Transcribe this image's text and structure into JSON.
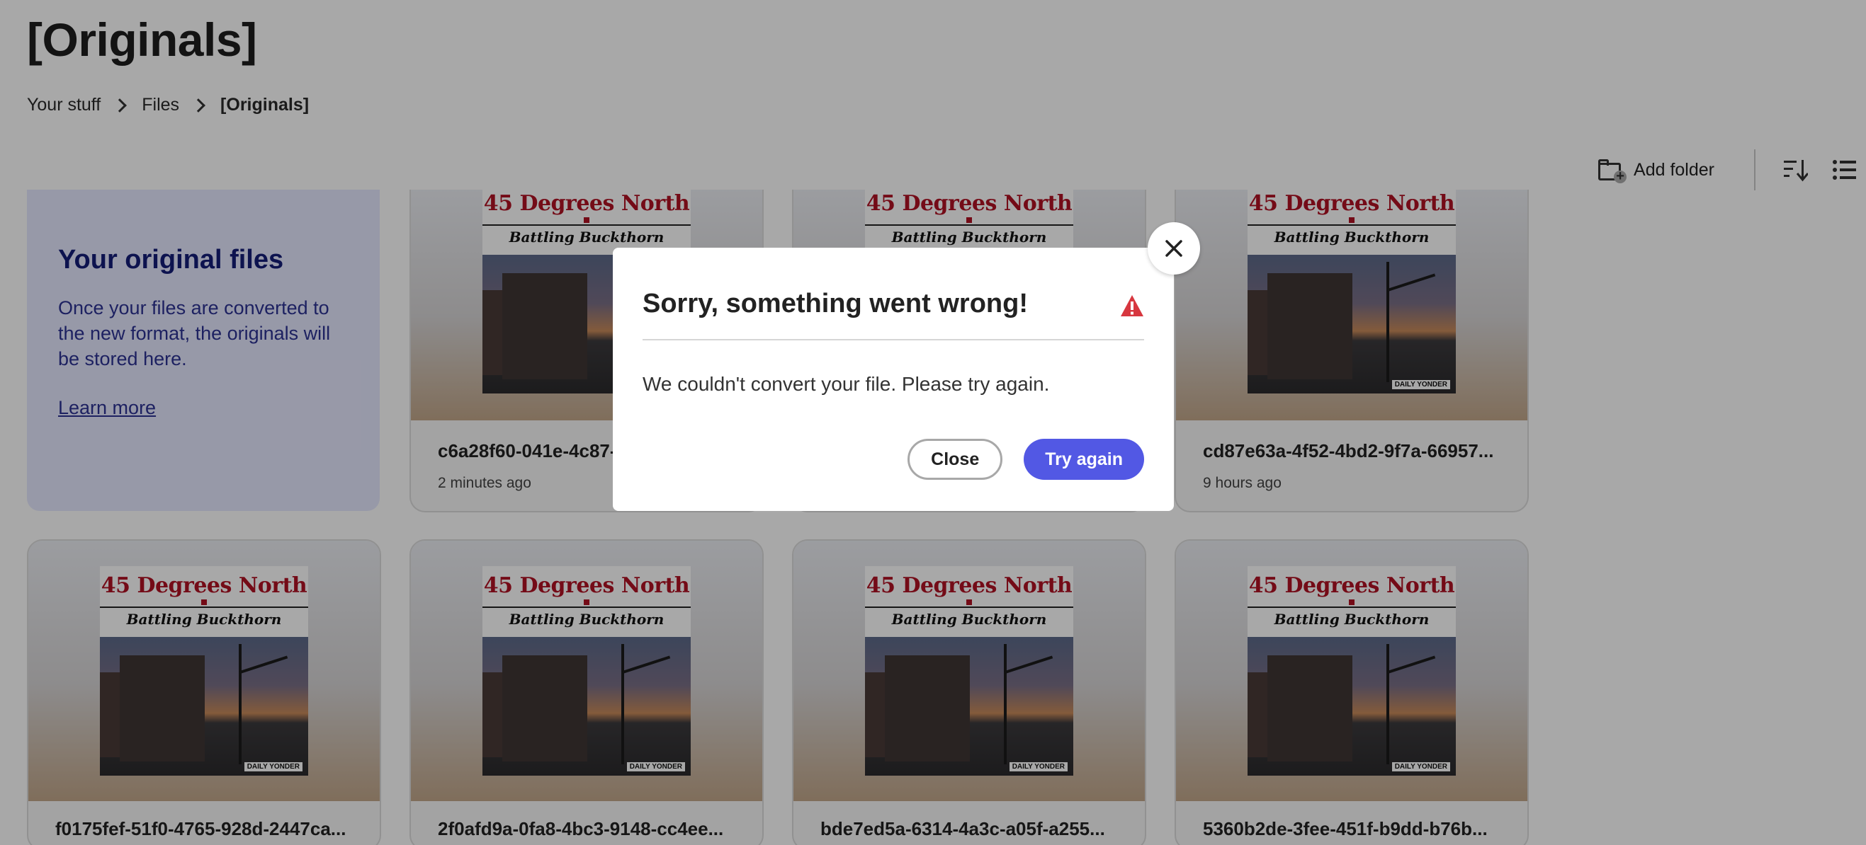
{
  "page": {
    "title": "[Originals]",
    "breadcrumb": [
      "Your stuff",
      "Files",
      "[Originals]"
    ]
  },
  "toolbar": {
    "add_folder_label": "Add folder",
    "sort_icon": "sort-icon",
    "view_icon": "list-view-icon"
  },
  "promo": {
    "heading": "Your original files",
    "body": "Once your files are converted to the new format, the originals will be stored here.",
    "link": "Learn more"
  },
  "thumbnail": {
    "headline": "45 Degrees North",
    "subtitle": "Battling Buckthorn",
    "credit": "DAILY YONDER"
  },
  "files": [
    {
      "name": "c6a28f60-041e-4c87-",
      "time": "2 minutes ago"
    },
    {
      "name": "",
      "time": ""
    },
    {
      "name": "cd87e63a-4f52-4bd2-9f7a-66957...",
      "time": "9 hours ago"
    },
    {
      "name": "f0175fef-51f0-4765-928d-2447ca...",
      "time": ""
    },
    {
      "name": "2f0afd9a-0fa8-4bc3-9148-cc4ee...",
      "time": ""
    },
    {
      "name": "bde7ed5a-6314-4a3c-a05f-a255...",
      "time": ""
    },
    {
      "name": "5360b2de-3fee-451f-b9dd-b76b...",
      "time": ""
    }
  ],
  "dialog": {
    "title": "Sorry, something went wrong!",
    "message": "We couldn't convert your file. Please try again.",
    "close_label": "Close",
    "retry_label": "Try again",
    "warning_color": "#d7373f",
    "primary_color": "#5258e4"
  }
}
